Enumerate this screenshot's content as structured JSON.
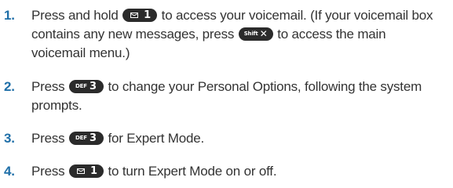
{
  "steps": [
    {
      "number": "1.",
      "line1_a": "Press and hold",
      "line1_b": "to access your voicemail. (If your voicemail box",
      "line2_a": "contains any new messages, press",
      "line2_b": "to access the main",
      "line3": "voicemail menu.)"
    },
    {
      "number": "2.",
      "line1_a": "Press",
      "line1_b": "to change your Personal Options, following the system",
      "line2": "prompts."
    },
    {
      "number": "3.",
      "line1_a": "Press",
      "line1_b": "for Expert Mode."
    },
    {
      "number": "4.",
      "line1_a": "Press",
      "line1_b": "to turn Expert Mode on or off."
    }
  ],
  "keys": {
    "key1": {
      "main": "1",
      "icon": "envelope-icon"
    },
    "key3": {
      "sub": "DEF",
      "main": "3"
    },
    "shiftx": {
      "sub": "Shift",
      "main": "✕"
    }
  },
  "colors": {
    "step_number": "#1f6fa8",
    "key_background": "#2b2b2b"
  }
}
